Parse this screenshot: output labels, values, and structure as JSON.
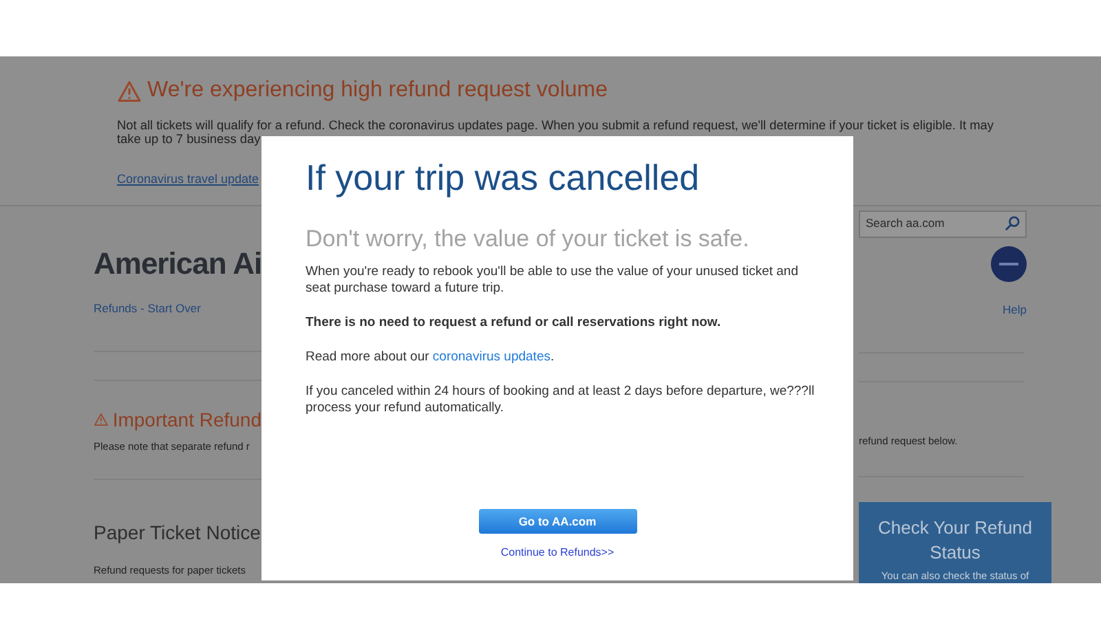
{
  "alert": {
    "title": "We're experiencing high refund request volume",
    "lines": [
      "Not all tickets will qualify for a refund. Check the coronavirus updates page. When you submit a refund request, we'll determine if your ticket is eligible. It may",
      "take up to 7 business day"
    ],
    "link": "Coronavirus travel update"
  },
  "header": {
    "logo": "American Ai",
    "breadcrumb": "Refunds - Start Over",
    "search": {
      "placeholder": "Search aa.com"
    },
    "help": "Help"
  },
  "important": {
    "title": "Important Refund",
    "left_text": "Please note that separate refund r",
    "right_text": "refund request below."
  },
  "paper_ticket": {
    "title": "Paper Ticket Notice",
    "text": "Refund requests for paper tickets"
  },
  "refund_status": {
    "title": "Check Your Refund Status",
    "text": "You can also check the status of"
  },
  "modal": {
    "title": "If your trip was cancelled",
    "subtitle": "Don't worry, the value of your ticket is safe.",
    "paragraphs": [
      {
        "kind": "plain",
        "text": "When you're ready to rebook you'll be able to use the value of your unused ticket and seat purchase toward a future trip."
      },
      {
        "kind": "bold",
        "text": "There is no need to request a refund or call reservations right now."
      },
      {
        "kind": "link",
        "text": "Read more about our ",
        "link": "coronavirus updates",
        "after": "."
      },
      {
        "kind": "plain",
        "text": "If you canceled within 24 hours of booking and at least 2 days before departure, we???ll process your refund automatically."
      }
    ],
    "button": "Go to AA.com",
    "secondary_link": "Continue to Refunds>>"
  }
}
